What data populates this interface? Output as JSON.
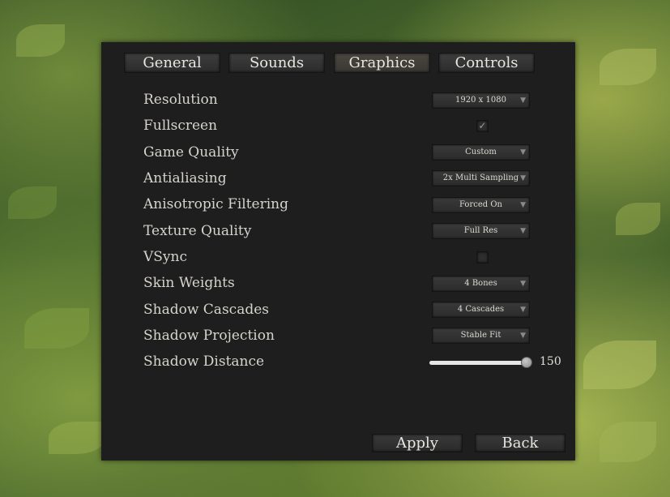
{
  "tabs": [
    {
      "label": "General"
    },
    {
      "label": "Sounds"
    },
    {
      "label": "Graphics"
    },
    {
      "label": "Controls"
    }
  ],
  "settings": {
    "resolution": {
      "label": "Resolution",
      "value": "1920 x 1080"
    },
    "fullscreen": {
      "label": "Fullscreen",
      "checked": true,
      "mark": "✓"
    },
    "game_quality": {
      "label": "Game Quality",
      "value": "Custom"
    },
    "antialiasing": {
      "label": "Antialiasing",
      "value": "2x Multi Sampling"
    },
    "anisotropic": {
      "label": "Anisotropic Filtering",
      "value": "Forced On"
    },
    "texture_quality": {
      "label": "Texture Quality",
      "value": "Full Res"
    },
    "vsync": {
      "label": "VSync",
      "checked": false,
      "mark": ""
    },
    "skin_weights": {
      "label": "Skin Weights",
      "value": "4 Bones"
    },
    "shadow_cascades": {
      "label": "Shadow Cascades",
      "value": "4 Cascades"
    },
    "shadow_projection": {
      "label": "Shadow Projection",
      "value": "Stable Fit"
    },
    "shadow_distance": {
      "label": "Shadow Distance",
      "value": "150",
      "fraction": 1.0
    }
  },
  "buttons": {
    "apply": "Apply",
    "back": "Back"
  },
  "icons": {
    "dropdown_chevron": "chevron-down-icon",
    "checkmark": "check-icon"
  }
}
